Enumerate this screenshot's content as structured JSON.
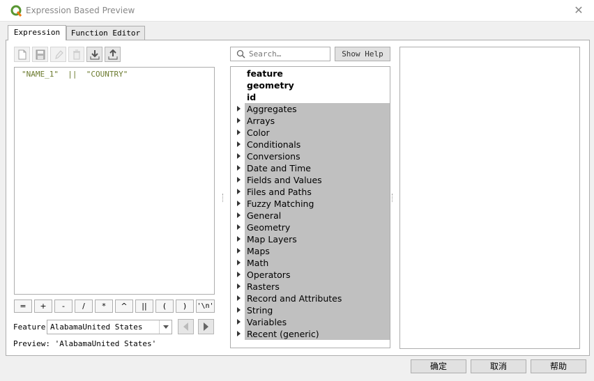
{
  "window": {
    "title": "Expression Based Preview",
    "close_icon": "close-icon"
  },
  "tabs": [
    {
      "label": "Expression"
    },
    {
      "label": "Function Editor"
    }
  ],
  "editor": {
    "text": "\"NAME_1\"  ||  \"COUNTRY\""
  },
  "operators": [
    "=",
    "+",
    "-",
    "/",
    "*",
    "^",
    "||",
    "(",
    ")",
    "'\\n'"
  ],
  "feature": {
    "label": "Feature",
    "value": "AlabamaUnited States"
  },
  "preview": {
    "text": "Preview: 'AlabamaUnited States'"
  },
  "search": {
    "placeholder": "Search…",
    "help_label": "Show Help"
  },
  "tree": {
    "top": [
      "feature",
      "geometry",
      "id"
    ],
    "groups": [
      "Aggregates",
      "Arrays",
      "Color",
      "Conditionals",
      "Conversions",
      "Date and Time",
      "Fields and Values",
      "Files and Paths",
      "Fuzzy Matching",
      "General",
      "Geometry",
      "Map Layers",
      "Maps",
      "Math",
      "Operators",
      "Rasters",
      "Record and Attributes",
      "String",
      "Variables",
      "Recent (generic)"
    ]
  },
  "buttons": {
    "ok": "确定",
    "cancel": "取消",
    "help": "帮助"
  },
  "colors": {
    "selection": "#c0c0c0",
    "expression_text": "#6b7a2e",
    "qgis_green": "#589632"
  }
}
